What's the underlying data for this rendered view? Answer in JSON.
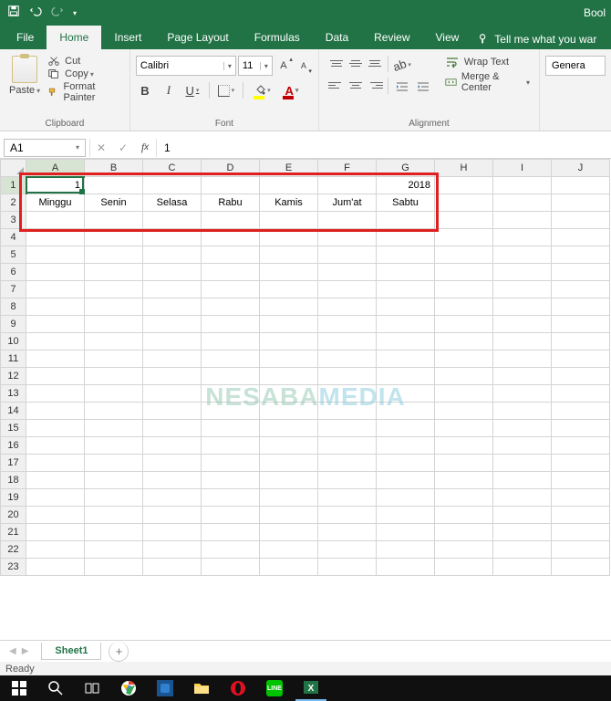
{
  "titlebar": {
    "title": "Bool"
  },
  "tabs": [
    "File",
    "Home",
    "Insert",
    "Page Layout",
    "Formulas",
    "Data",
    "Review",
    "View"
  ],
  "active_tab": 1,
  "tellme": "Tell me what you war",
  "clipboard": {
    "paste": "Paste",
    "cut": "Cut",
    "copy": "Copy",
    "painter": "Format Painter",
    "group": "Clipboard"
  },
  "font": {
    "name": "Calibri",
    "size": "11",
    "group": "Font"
  },
  "alignment": {
    "wrap": "Wrap Text",
    "merge": "Merge & Center",
    "group": "Alignment"
  },
  "number": {
    "format": "Genera"
  },
  "namebox": "A1",
  "formula": "1",
  "cols": [
    "A",
    "B",
    "C",
    "D",
    "E",
    "F",
    "G",
    "H",
    "I",
    "J"
  ],
  "rows": 23,
  "cells": {
    "A1": "1",
    "G1": "2018",
    "A2": "Minggu",
    "B2": "Senin",
    "C2": "Selasa",
    "D2": "Rabu",
    "E2": "Kamis",
    "F2": "Jum'at",
    "G2": "Sabtu"
  },
  "watermark1": "NESABA",
  "watermark2": "MEDIA",
  "sheet": "Sheet1",
  "status": "Ready"
}
